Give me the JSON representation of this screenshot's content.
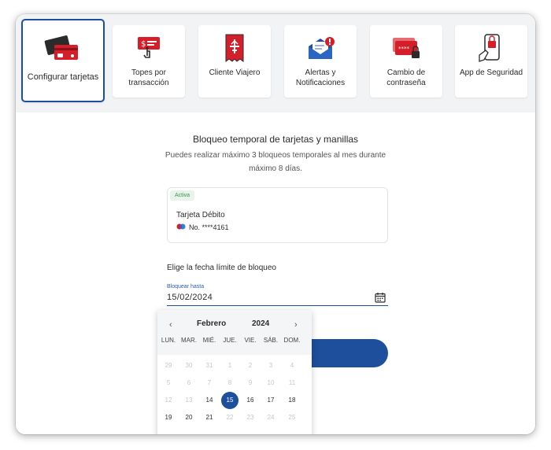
{
  "tabs": [
    {
      "label": "Configurar tarjetas",
      "icon": "cards-icon"
    },
    {
      "label": "Topes por transacción",
      "icon": "transaction-limit-icon"
    },
    {
      "label": "Cliente Viajero",
      "icon": "travel-receipt-icon"
    },
    {
      "label": "Alertas y Notificaciones",
      "icon": "notification-envelope-icon"
    },
    {
      "label": "Cambio de contraseña",
      "icon": "password-card-icon"
    },
    {
      "label": "App de Seguridad",
      "icon": "security-app-icon"
    }
  ],
  "main": {
    "title": "Bloqueo temporal de tarjetas y manillas",
    "subtitle": "Puedes realizar máximo 3 bloqueos temporales al mes durante máximo 8 días."
  },
  "card": {
    "status": "Activa",
    "name": "Tarjeta Débito",
    "number": "No. ****4161"
  },
  "date_section": {
    "label": "Elige la fecha límite de bloqueo",
    "field_caption": "Bloquear hasta",
    "field_value": "15/02/2024"
  },
  "calendar": {
    "prev": "‹",
    "next": "›",
    "month": "Febrero",
    "year": "2024",
    "weekdays": [
      "LUN.",
      "MAR.",
      "MIÉ.",
      "JUE.",
      "VIE.",
      "SÁB.",
      "DOM."
    ],
    "rows": [
      [
        "29",
        "30",
        "31",
        "1",
        "2",
        "3",
        "4"
      ],
      [
        "5",
        "6",
        "7",
        "8",
        "9",
        "10",
        "11"
      ],
      [
        "12",
        "13",
        "14",
        "15",
        "16",
        "17",
        "18"
      ],
      [
        "19",
        "20",
        "21",
        "22",
        "23",
        "24",
        "25"
      ]
    ],
    "selected": "15"
  },
  "colors": {
    "accent": "#1d4f9c",
    "brand_red": "#d41f2b",
    "badge_green": "#3e8f52"
  }
}
